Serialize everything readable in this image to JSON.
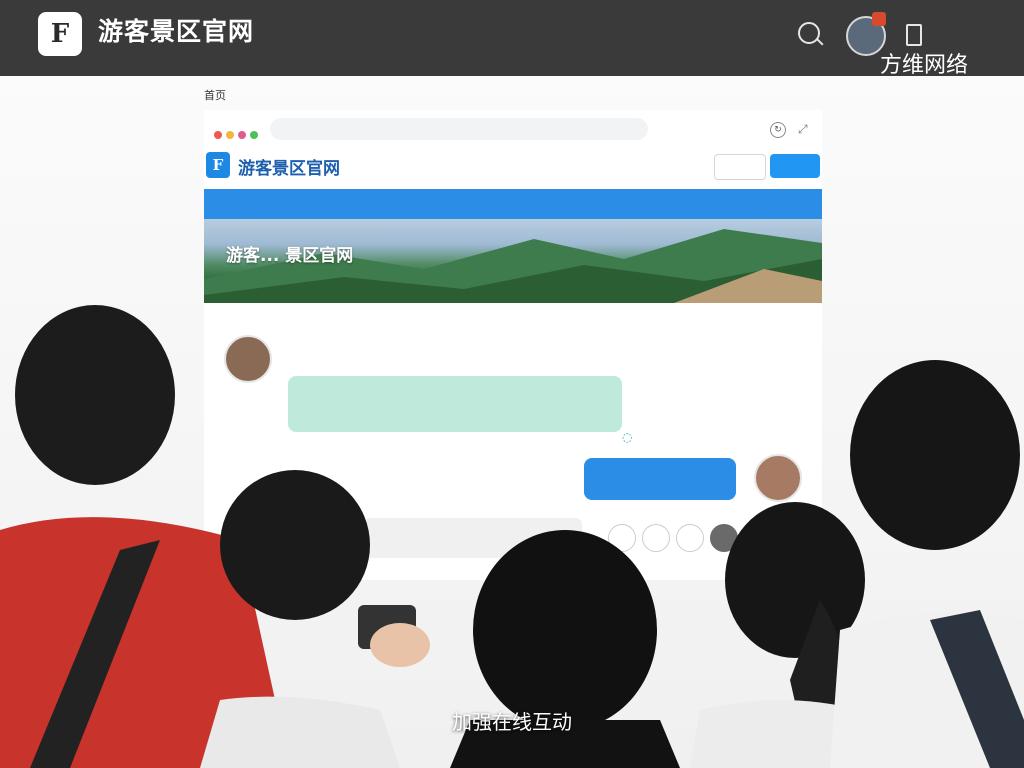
{
  "header": {
    "logo_glyph": "F",
    "title": "游客景区官网",
    "subtitle": "",
    "top_label": "",
    "badge": "",
    "brand_caption": "方维网络"
  },
  "outer_nav": {
    "left": [
      "首页",
      "",
      ""
    ],
    "right": [
      "",
      "",
      ""
    ]
  },
  "browser": {
    "url": "",
    "site_logo": "F",
    "site_title": "游客景区官网",
    "site_sub": "",
    "login_label": "",
    "register_label": "",
    "nav_tabs": [
      "",
      "",
      ""
    ],
    "nav_icons": "",
    "banner_title": "游客... 景区官网",
    "banner_sub": "",
    "chat_meta": "",
    "agent_name": "",
    "incoming_message": "",
    "outgoing_message": "",
    "tools": [
      "",
      "",
      "",
      ""
    ]
  },
  "footer": {
    "caption": "加强在线互动"
  },
  "colors": {
    "topbar": "#3a3a3a",
    "primary_blue": "#2b8de6",
    "bubble_green": "#bfeadb"
  }
}
